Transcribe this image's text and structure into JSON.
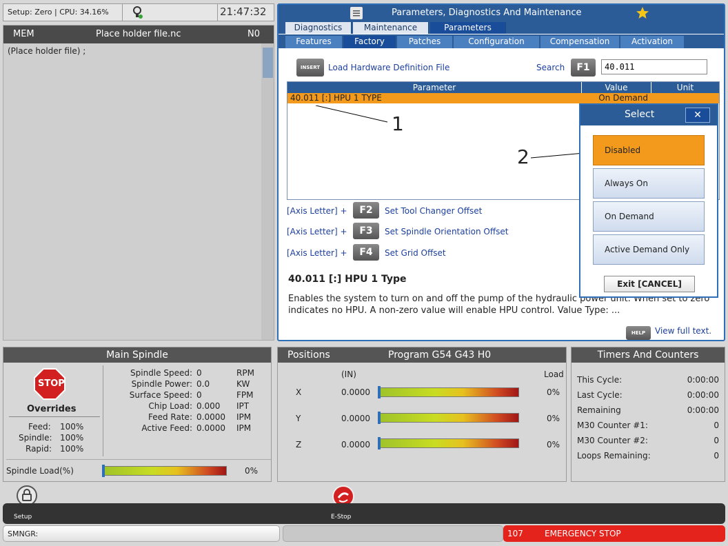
{
  "topbar": {
    "setup": "Setup: Zero | CPU: 34.16%",
    "time": "21:47:32"
  },
  "program": {
    "mode": "MEM",
    "file": "Place holder file.nc",
    "n": "N0",
    "code": "(Place holder file) ;"
  },
  "pdm": {
    "title": "Parameters, Diagnostics And Maintenance",
    "tabs1": [
      "Diagnostics",
      "Maintenance",
      "Parameters"
    ],
    "tabs2": [
      "Features",
      "Factory",
      "Patches",
      "Configuration",
      "Compensation",
      "Activation"
    ],
    "insert_key": "INSERT",
    "load_hw": "Load Hardware Definition File",
    "search_label": "Search",
    "f1": "F1",
    "search_value": "40.011",
    "table_headers": {
      "param": "Parameter",
      "value": "Value",
      "unit": "Unit"
    },
    "row": {
      "param": "40.011 [:] HPU 1 TYPE",
      "value": "On Demand",
      "unit": ""
    },
    "callout1": "1",
    "callout2": "2",
    "fkeys": [
      {
        "prefix": "[Axis Letter] +",
        "key": "F2",
        "label": "Set Tool Changer Offset"
      },
      {
        "prefix": "[Axis Letter] +",
        "key": "F3",
        "label": "Set Spindle Orientation Offset"
      },
      {
        "prefix": "[Axis Letter] +",
        "key": "F4",
        "label": "Set Grid Offset"
      }
    ],
    "desc_title": "40.011 [:] HPU 1 Type",
    "desc_text": "Enables the system to turn on and off the pump of the hydraulic power unit. When set to zero indicates no HPU. A non-zero value will enable HPU control. Value Type: ...",
    "help_key": "HELP",
    "view_full": "View full text."
  },
  "select": {
    "title": "Select",
    "close": "✕",
    "options": [
      "Disabled",
      "Always On",
      "On Demand",
      "Active Demand Only"
    ],
    "selected": "Disabled",
    "exit": "Exit [CANCEL]"
  },
  "spindle": {
    "title": "Main Spindle",
    "stop": "STOP",
    "overrides": "Overrides",
    "feed_label": "Feed:",
    "feed": "100%",
    "spindle_label": "Spindle:",
    "spindle_pct": "100%",
    "rapid_label": "Rapid:",
    "rapid": "100%",
    "rows": [
      {
        "label": "Spindle Speed:",
        "value": "0",
        "unit": "RPM"
      },
      {
        "label": "Spindle Power:",
        "value": "0.0",
        "unit": "KW"
      },
      {
        "label": "Surface Speed:",
        "value": "0",
        "unit": "FPM"
      },
      {
        "label": "Chip Load:",
        "value": "0.000",
        "unit": "IPT"
      },
      {
        "label": "Feed Rate:",
        "value": "0.0000",
        "unit": "IPM"
      },
      {
        "label": "Active Feed:",
        "value": "0.0000",
        "unit": "IPM"
      }
    ],
    "load_label": "Spindle Load(%)",
    "load_value": "0%"
  },
  "positions": {
    "title": "Positions",
    "program": "Program G54 G43 H0",
    "units": "(IN)",
    "load": "Load",
    "axes": [
      {
        "axis": "X",
        "value": "0.0000",
        "load": "0%"
      },
      {
        "axis": "Y",
        "value": "0.0000",
        "load": "0%"
      },
      {
        "axis": "Z",
        "value": "0.0000",
        "load": "0%"
      }
    ]
  },
  "timers": {
    "title": "Timers And Counters",
    "rows": [
      {
        "label": "This Cycle:",
        "value": "0:00:00"
      },
      {
        "label": "Last Cycle:",
        "value": "0:00:00"
      },
      {
        "label": "Remaining",
        "value": "0:00:00"
      },
      {
        "label": "M30 Counter #1:",
        "value": "0"
      },
      {
        "label": "M30 Counter #2:",
        "value": "0"
      },
      {
        "label": "Loops Remaining:",
        "value": "0"
      }
    ]
  },
  "bottom": {
    "setup": "Setup",
    "estop": "E-Stop",
    "smngr": "SMNGR:",
    "alarm_code": "107",
    "alarm_text": "EMERGENCY STOP"
  }
}
